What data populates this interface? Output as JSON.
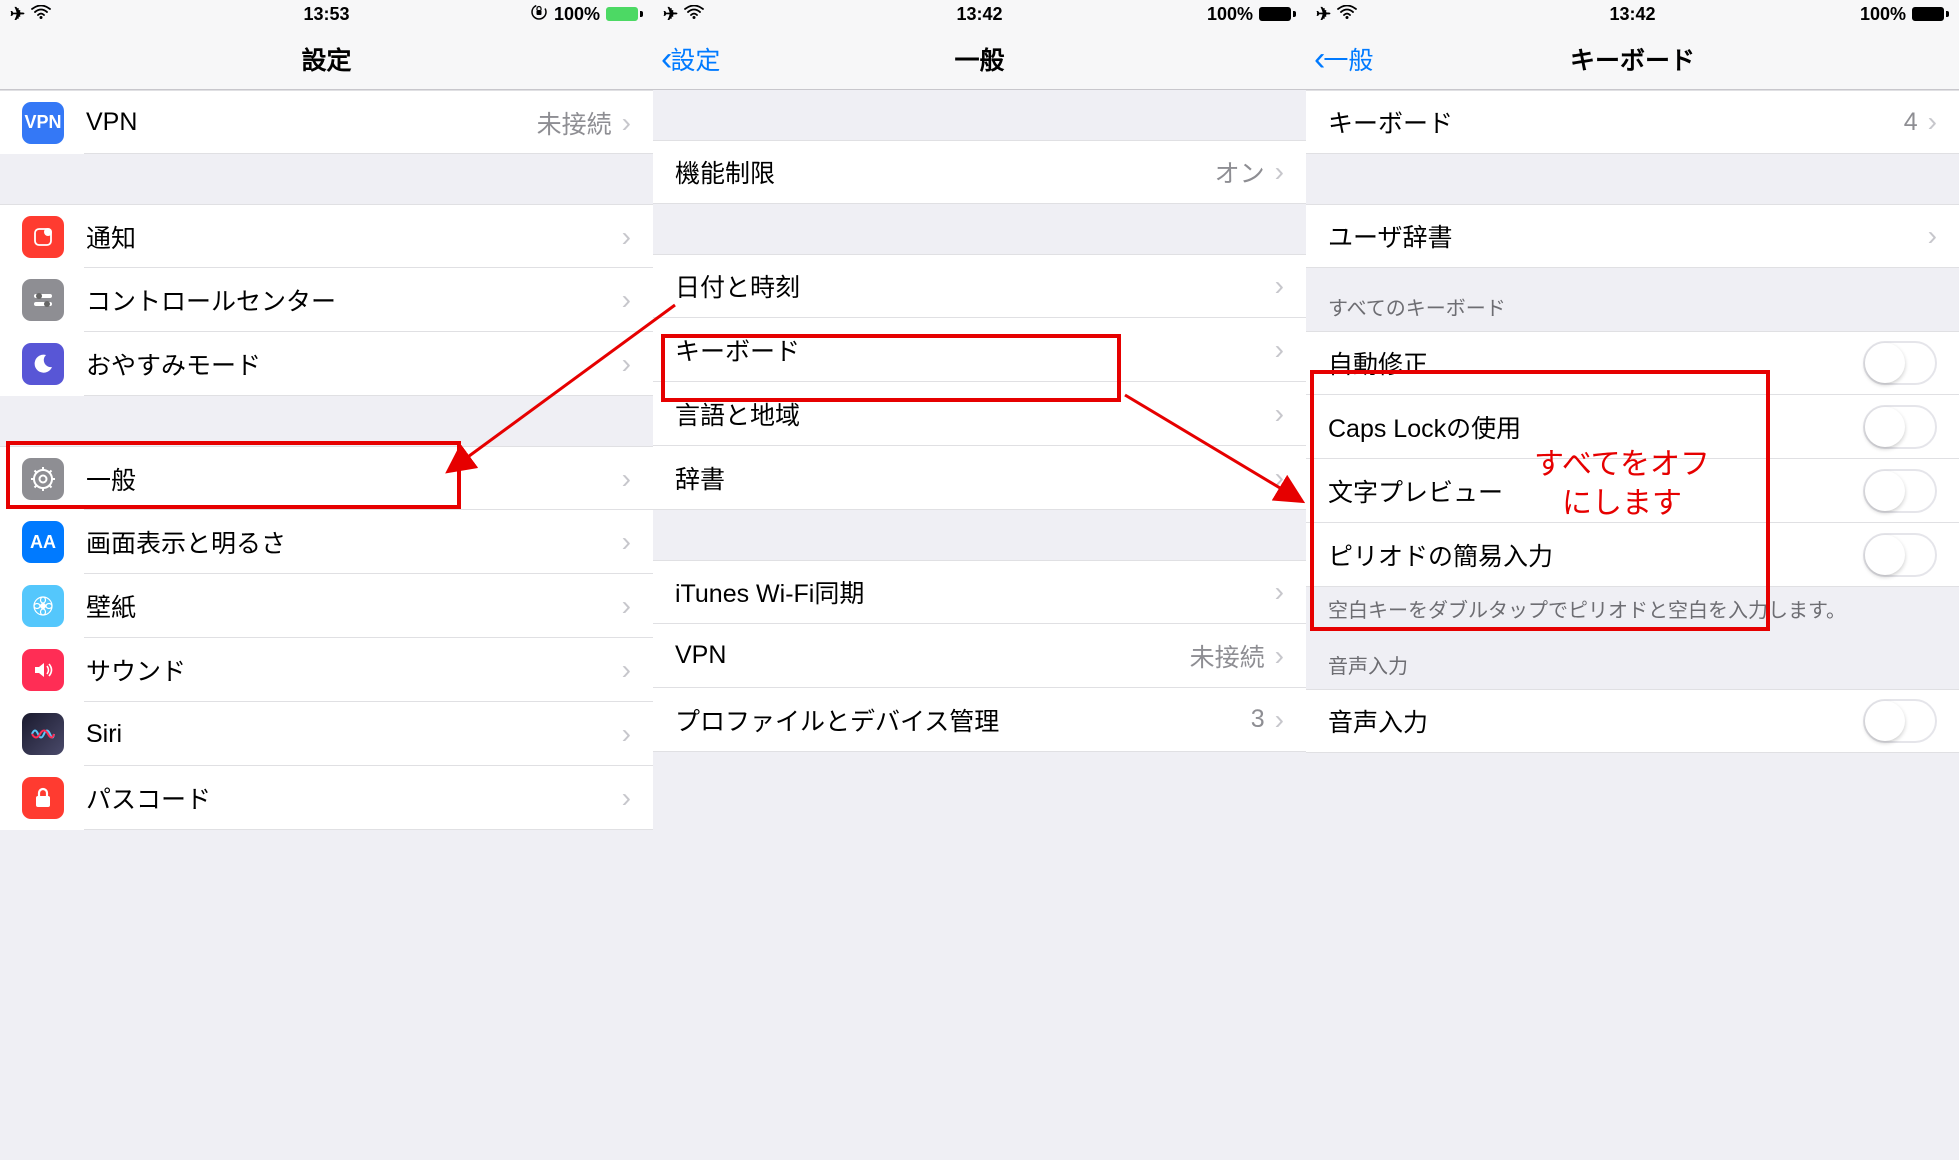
{
  "screen1": {
    "status": {
      "time": "13:53",
      "battery": "100%"
    },
    "nav": {
      "title": "設定"
    },
    "rows": {
      "vpn": {
        "label": "VPN",
        "detail": "未接続",
        "icon_text": "VPN"
      },
      "notif": {
        "label": "通知"
      },
      "cc": {
        "label": "コントロールセンター"
      },
      "dnd": {
        "label": "おやすみモード"
      },
      "general": {
        "label": "一般"
      },
      "display": {
        "label": "画面表示と明るさ",
        "icon_text": "AA"
      },
      "wallpaper": {
        "label": "壁紙"
      },
      "sound": {
        "label": "サウンド"
      },
      "siri": {
        "label": "Siri"
      },
      "passcode": {
        "label": "パスコード"
      }
    }
  },
  "screen2": {
    "status": {
      "time": "13:42",
      "battery": "100%"
    },
    "nav": {
      "back": "設定",
      "title": "一般"
    },
    "rows": {
      "restrictions": {
        "label": "機能制限",
        "detail": "オン"
      },
      "datetime": {
        "label": "日付と時刻"
      },
      "keyboard": {
        "label": "キーボード"
      },
      "language": {
        "label": "言語と地域"
      },
      "dictionary": {
        "label": "辞書"
      },
      "itunes": {
        "label": "iTunes Wi-Fi同期"
      },
      "vpn": {
        "label": "VPN",
        "detail": "未接続"
      },
      "profile": {
        "label": "プロファイルとデバイス管理",
        "detail": "3"
      }
    }
  },
  "screen3": {
    "status": {
      "time": "13:42",
      "battery": "100%"
    },
    "nav": {
      "back": "一般",
      "title": "キーボード"
    },
    "rows": {
      "keyboards": {
        "label": "キーボード",
        "detail": "4"
      },
      "userdict": {
        "label": "ユーザ辞書"
      }
    },
    "section_all_kb": {
      "header": "すべてのキーボード"
    },
    "toggles": {
      "autocorrect": {
        "label": "自動修正"
      },
      "capslock": {
        "label": "Caps Lockの使用"
      },
      "preview": {
        "label": "文字プレビュー"
      },
      "period": {
        "label": "ピリオドの簡易入力"
      }
    },
    "footer_period": "空白キーをダブルタップでピリオドと空白を入力します。",
    "section_voice": {
      "header": "音声入力"
    },
    "voice": {
      "label": "音声入力"
    }
  },
  "annotation": {
    "line1": "すべてをオフ",
    "line2": "にします"
  }
}
